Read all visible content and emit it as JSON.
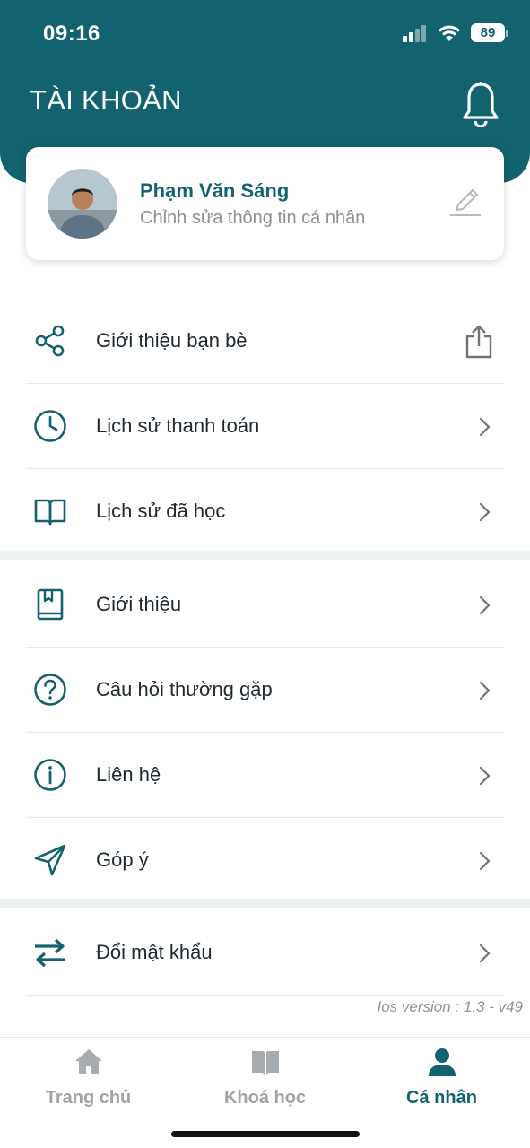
{
  "status_bar": {
    "time": "09:16",
    "battery": "89"
  },
  "header": {
    "title": "TÀI KHOẢN",
    "notification_icon": "bell-icon"
  },
  "profile": {
    "name": "Phạm Văn Sáng",
    "subtitle": "Chỉnh sửa thông tin cá nhân",
    "edit_icon": "pencil-icon"
  },
  "menu": {
    "group1": [
      {
        "label": "Giới thiệu bạn bè",
        "icon": "share-icon",
        "action_icon": "upload-icon"
      },
      {
        "label": "Lịch sử thanh toán",
        "icon": "clock-icon",
        "action_icon": "chevron-right-icon"
      },
      {
        "label": "Lịch sử đã học",
        "icon": "book-open-icon",
        "action_icon": "chevron-right-icon"
      }
    ],
    "group2": [
      {
        "label": "Giới thiệu",
        "icon": "bookmark-book-icon",
        "action_icon": "chevron-right-icon"
      },
      {
        "label": "Câu hỏi thường gặp",
        "icon": "question-icon",
        "action_icon": "chevron-right-icon"
      },
      {
        "label": "Liên hệ",
        "icon": "info-icon",
        "action_icon": "chevron-right-icon"
      },
      {
        "label": "Góp ý",
        "icon": "send-icon",
        "action_icon": "chevron-right-icon"
      }
    ],
    "group3": [
      {
        "label": "Đổi mật khẩu",
        "icon": "swap-arrows-icon",
        "action_icon": "chevron-right-icon"
      }
    ]
  },
  "version": "Ios version : 1.3 - v49",
  "tabbar": {
    "tabs": [
      {
        "label": "Trang chủ",
        "icon": "home-icon",
        "active": false
      },
      {
        "label": "Khoá học",
        "icon": "book-icon",
        "active": false
      },
      {
        "label": "Cá nhân",
        "icon": "user-icon",
        "active": true
      }
    ]
  },
  "colors": {
    "primary": "#12636f",
    "inactive": "#9ea4a8",
    "separator": "#eef1f2"
  }
}
